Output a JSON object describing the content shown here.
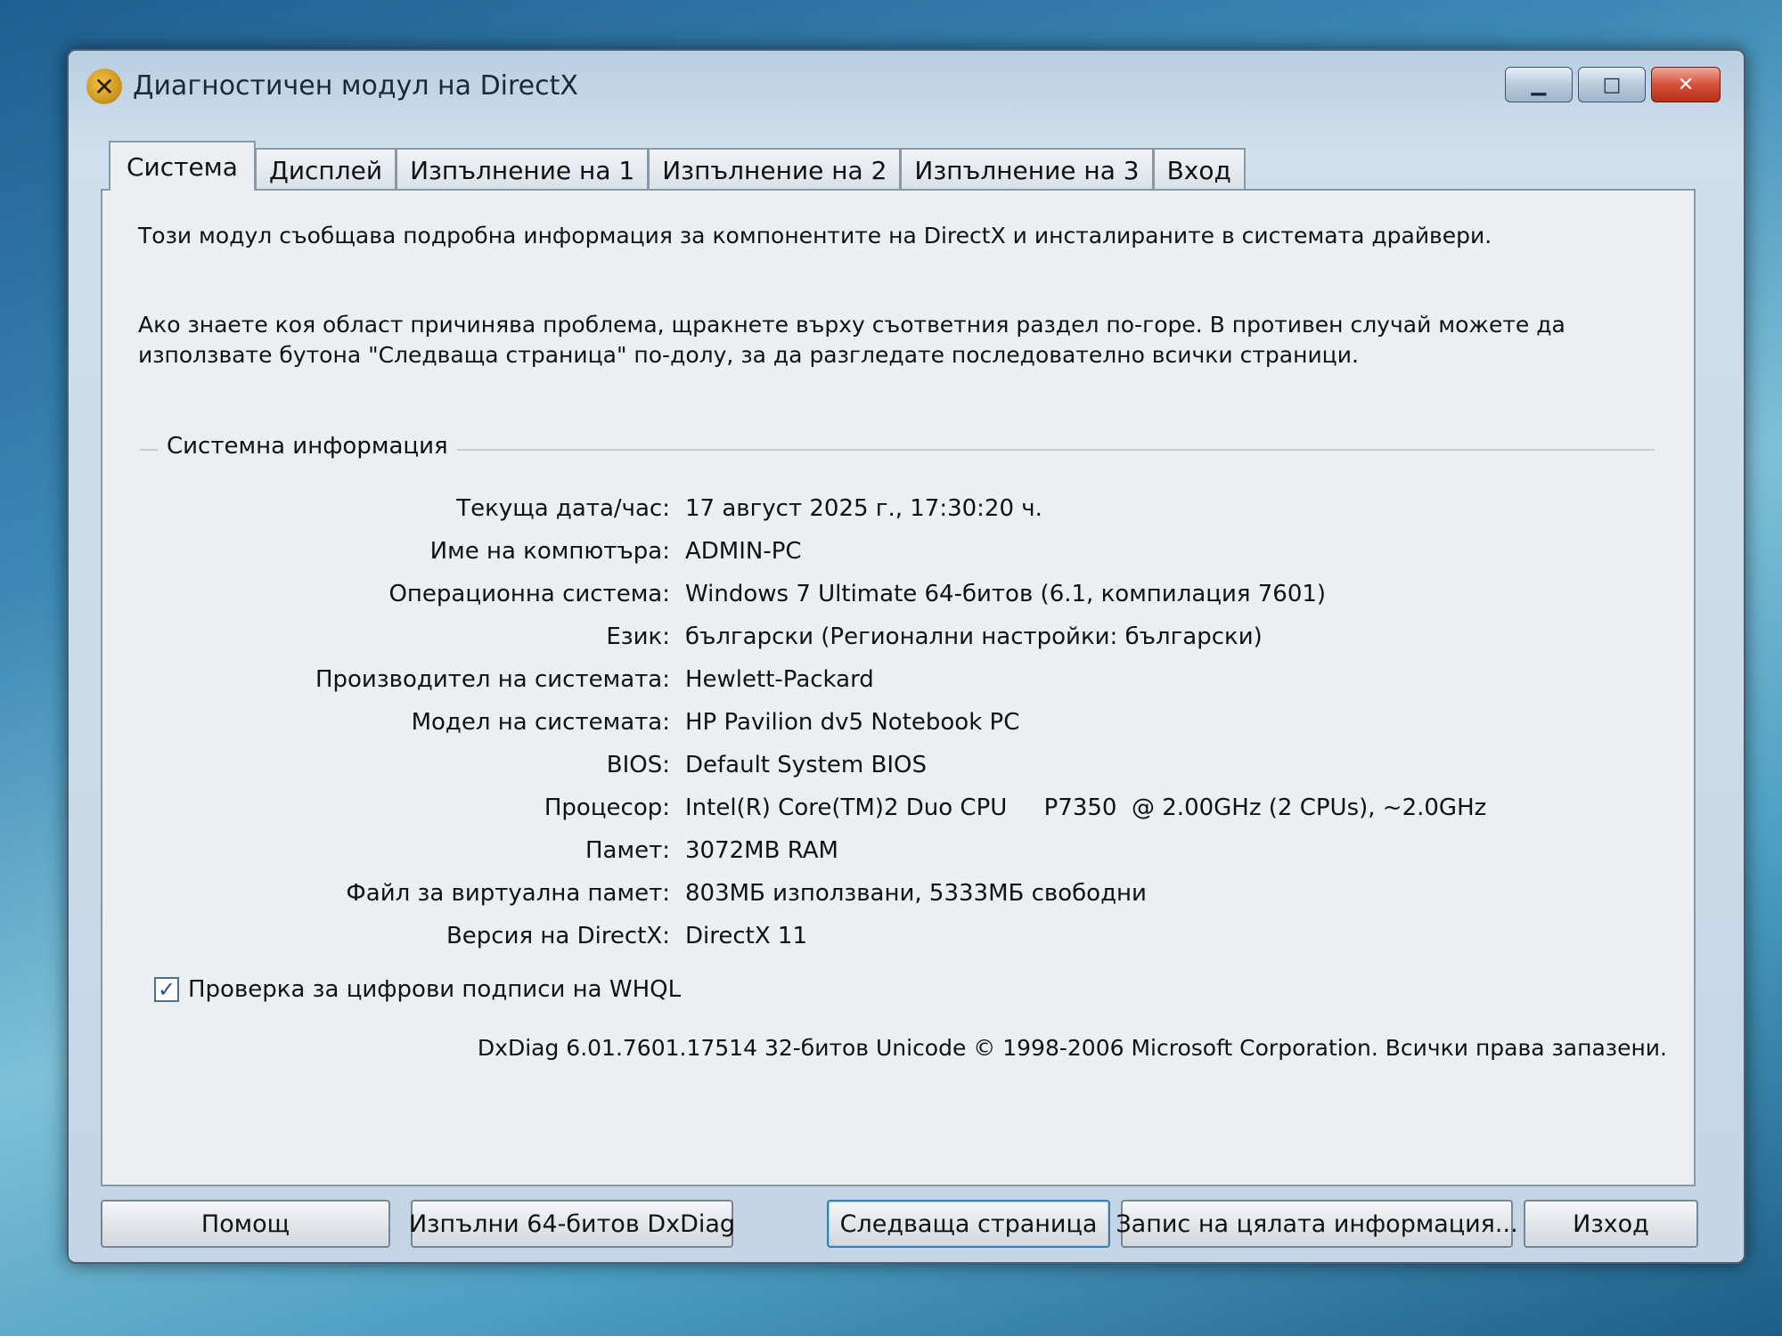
{
  "window": {
    "title": "Диагностичен модул на DirectX",
    "icon": "directx-icon",
    "buttons": {
      "minimize": "minimize-icon",
      "maximize": "maximize-icon",
      "close": "close-icon"
    }
  },
  "tabs": [
    {
      "label": "Система",
      "active": true
    },
    {
      "label": "Дисплей"
    },
    {
      "label": "Изпълнение на 1"
    },
    {
      "label": "Изпълнение на 2"
    },
    {
      "label": "Изпълнение на 3"
    },
    {
      "label": "Вход"
    }
  ],
  "intro": {
    "line1": "Този модул съобщава подробна информация за компонентите на DirectX и инсталираните в системата драйвери.",
    "line2": "Ако знаете коя област причинява проблема, щракнете върху съответния раздел по-горе. В противен случай можете да",
    "line3": "използвате бутона \"Следваща страница\" по-долу, за да разгледате последователно всички страници."
  },
  "system_info": {
    "title": "Системна информация",
    "rows": [
      {
        "label": "Текуща дата/час:",
        "value": "17 август 2025 г., 17:30:20 ч."
      },
      {
        "label": "Име на компютъра:",
        "value": "ADMIN-PC"
      },
      {
        "label": "Операционна система:",
        "value": "Windows 7 Ultimate 64-битов (6.1, компилация 7601)"
      },
      {
        "label": "Език:",
        "value": "български (Регионални настройки: български)"
      },
      {
        "label": "Производител на системата:",
        "value": "Hewlett-Packard"
      },
      {
        "label": "Модел на системата:",
        "value": "HP Pavilion dv5 Notebook PC"
      },
      {
        "label": "BIOS:",
        "value": "Default System BIOS"
      },
      {
        "label": "Процесор:",
        "value": "Intel(R) Core(TM)2 Duo CPU     P7350  @ 2.00GHz (2 CPUs), ~2.0GHz"
      },
      {
        "label": "Памет:",
        "value": "3072MB RAM"
      },
      {
        "label": "Файл за виртуална памет:",
        "value": "803МБ използвани, 5333МБ свободни"
      },
      {
        "label": "Версия на DirectX:",
        "value": "DirectX 11"
      }
    ]
  },
  "whql_check": {
    "label": "Проверка за цифрови подписи на WHQL",
    "checked": true
  },
  "footer": "DxDiag 6.01.7601.17514 32-битов Unicode © 1998-2006 Microsoft Corporation. Всички права запазени.",
  "buttons": {
    "help": "Помощ",
    "run64": "Изпълни 64-битов DxDiag",
    "next": "Следваща страница",
    "save": "Запис на цялата информация...",
    "exit": "Изход"
  }
}
